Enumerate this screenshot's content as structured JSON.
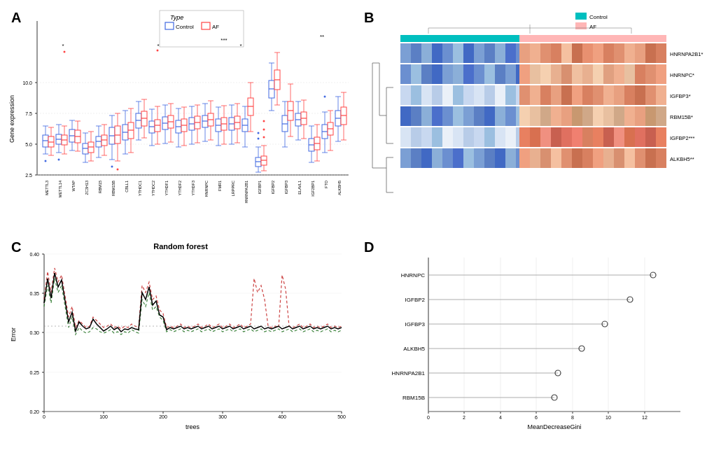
{
  "panels": {
    "a": {
      "label": "A",
      "title": "",
      "y_axis": "Gene expression",
      "legend": {
        "title": "Type",
        "items": [
          {
            "label": "Control",
            "color": "#4169E1"
          },
          {
            "label": "AF",
            "color": "#FF6B6B"
          }
        ]
      },
      "genes": [
        "METTL3",
        "METTL14",
        "WTAP",
        "ZC3H13",
        "RBM15",
        "RBM15B",
        "CBLL1",
        "YTHDC1",
        "YTHDC2",
        "YTHDF1",
        "YTHDF2",
        "YTHDF3",
        "HNRNPC",
        "FMR1",
        "LRPPRC",
        "HNRNPA2B1",
        "IGFBP1",
        "IGFBP2",
        "IGFBP3",
        "ELAVL1",
        "IGF2BP1",
        "FTO",
        "ALKBH5"
      ]
    },
    "b": {
      "label": "B",
      "legend": {
        "items": [
          {
            "label": "Control",
            "color": "#00BFBF"
          },
          {
            "label": "AF",
            "color": "#FFB6B6"
          }
        ]
      },
      "genes": [
        "HNRNPA2B1*",
        "HNRNPC*",
        "IGFBP3*",
        "RBM15B*",
        "IGFBP2***",
        "ALKBH5**"
      ]
    },
    "c": {
      "label": "C",
      "title": "Random forest",
      "x_axis": "trees",
      "y_axis": "Error",
      "y_min": 0.2,
      "y_max": 0.4,
      "x_max": 500
    },
    "d": {
      "label": "D",
      "x_axis": "MeanDecreaseGini",
      "genes": [
        "HNRNPC",
        "IGFBP2",
        "IGFBP3",
        "ALKBH5",
        "HNRNPA2B1",
        "RBM15B"
      ],
      "values": [
        12.5,
        11.2,
        9.8,
        8.5,
        7.2,
        7.0
      ],
      "x_max": 14
    }
  }
}
